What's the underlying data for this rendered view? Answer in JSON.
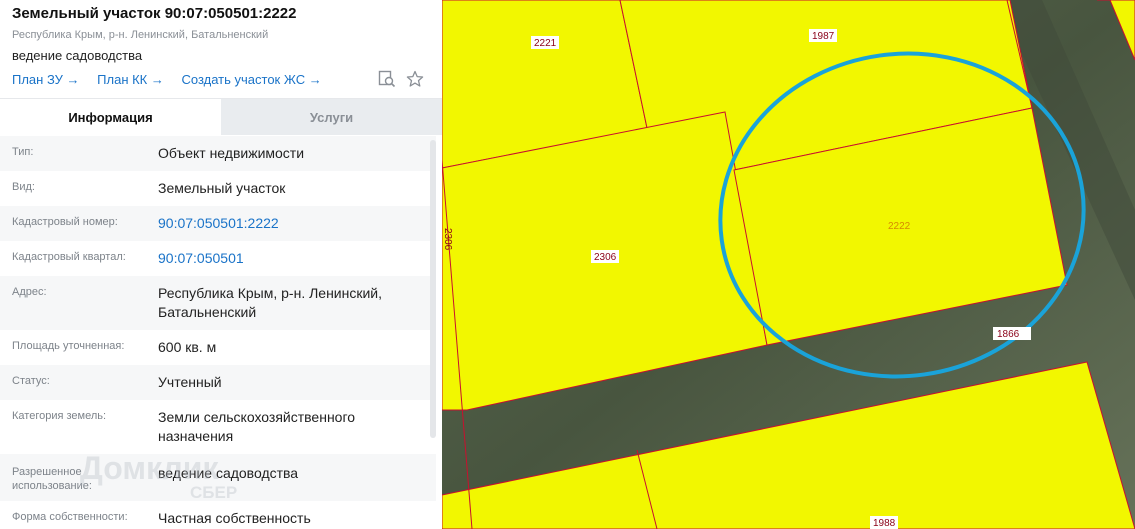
{
  "parcel": {
    "title": "Земельный участок 90:07:050501:2222",
    "address": "Республика Крым, р-н. Ленинский, Батальненский",
    "purpose": "ведение садоводства"
  },
  "links": {
    "plan_zu": "План ЗУ →",
    "plan_kk": "План КК →",
    "create_zhs": "Создать участок ЖС →"
  },
  "tabs": {
    "info": "Информация",
    "services": "Услуги"
  },
  "rows": [
    {
      "label": "Тип:",
      "value": "Объект недвижимости"
    },
    {
      "label": "Вид:",
      "value": "Земельный участок"
    },
    {
      "label": "Кадастровый номер:",
      "value": "90:07:050501:2222"
    },
    {
      "label": "Кадастровый квартал:",
      "value": "90:07:050501"
    },
    {
      "label": "Адрес:",
      "value": "Республика Крым, р-н. Ленинский, Батальненский"
    },
    {
      "label": "Площадь уточненная:",
      "value": "600 кв. м"
    },
    {
      "label": "Статус:",
      "value": "Учтенный"
    },
    {
      "label": "Категория земель:",
      "value": "Земли сельскохозяйственного назначения"
    },
    {
      "label": "Разрешенное использование:",
      "value": "ведение садоводства"
    },
    {
      "label": "Форма собственности:",
      "value": "Частная собственность"
    }
  ],
  "watermark": {
    "brand": "Домклик",
    "sub": "СБЕР"
  },
  "map": {
    "labels": {
      "p2221": "2221",
      "p1987": "1987",
      "p2306": "2306",
      "p2306_side": "2306",
      "p2222": "2222",
      "p1866": "1866",
      "p1988": "1988"
    },
    "colors": {
      "parcel_fill": "#f2f700",
      "parcel_border": "#c8102e",
      "highlight_circle": "#1aa3d9",
      "ground": "#4e5a48"
    }
  }
}
